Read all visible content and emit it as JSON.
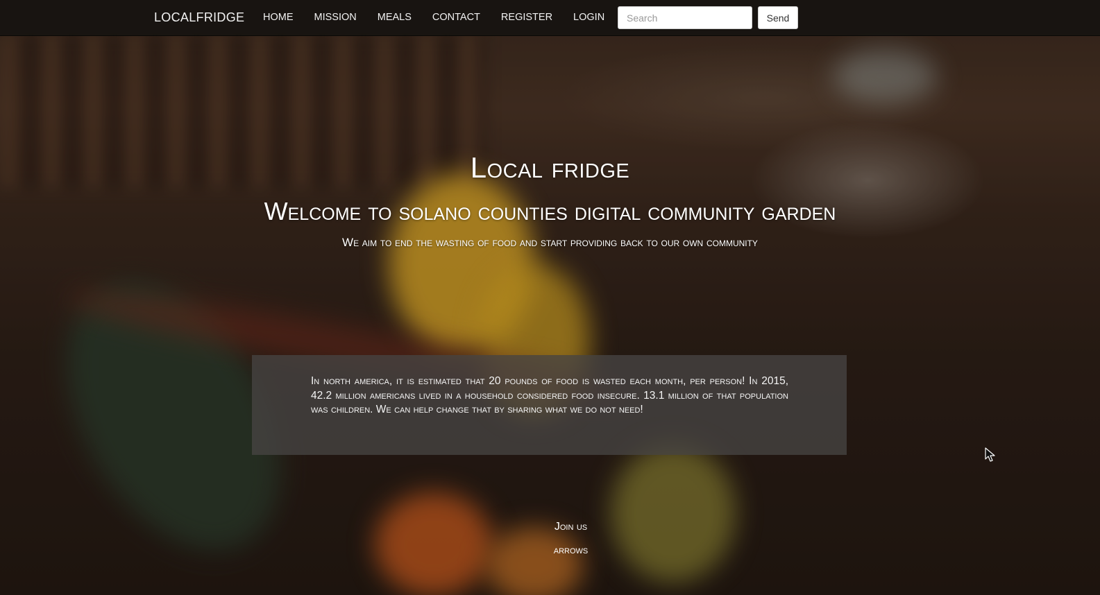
{
  "navbar": {
    "brand": "LOCALFRIDGE",
    "links": [
      "HOME",
      "MISSION",
      "MEALS",
      "CONTACT",
      "REGISTER",
      "LOGIN"
    ],
    "search_placeholder": "Search",
    "search_value": "",
    "send_label": "Send"
  },
  "hero": {
    "title": "Local fridge",
    "subtitle": "Welcome to solano counties digital community garden",
    "tagline": "We aim to end the wasting of food and start providing back to our own community"
  },
  "info": {
    "text": "In north america, it is estimated that 20 pounds of food is wasted each month, per person! In 2015, 42.2 million americans lived in a household considered food insecure. 13.1 million of that population was children. We can help change that by sharing what we do not need!"
  },
  "footer": {
    "join_label": "Join us",
    "arrows_label": "arrows"
  },
  "icons": {
    "cursor": "mouse-pointer-icon"
  },
  "colors": {
    "navbar_bg": "#141210",
    "text": "#ffffff",
    "info_box_bg": "#464442"
  }
}
